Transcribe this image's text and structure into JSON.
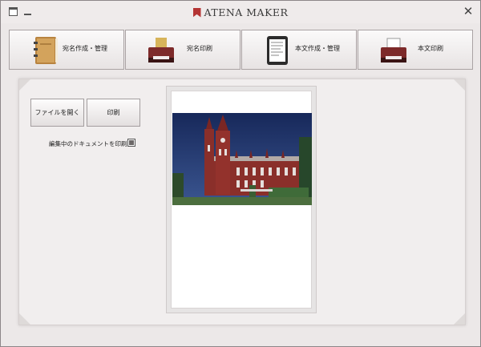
{
  "window": {
    "title": "ATENA MAKER",
    "close_symbol": "✕"
  },
  "toolbar": {
    "buttons": [
      {
        "label": "宛名作成・管理",
        "icon": "address-book-icon"
      },
      {
        "label": "宛名印刷",
        "icon": "printer-envelope-icon"
      },
      {
        "label": "本文作成・管理",
        "icon": "tablet-document-icon"
      },
      {
        "label": "本文印刷",
        "icon": "printer-paper-icon"
      }
    ]
  },
  "main": {
    "open_file_label": "ファイルを開く",
    "print_label": "印刷",
    "print_current_label": "編集中のドキュメントを印刷",
    "print_current_checked": true,
    "preview_image": "church-photo"
  },
  "colors": {
    "brand_red": "#b43434",
    "sky": "#1f3566",
    "brick": "#8a2f2a"
  }
}
